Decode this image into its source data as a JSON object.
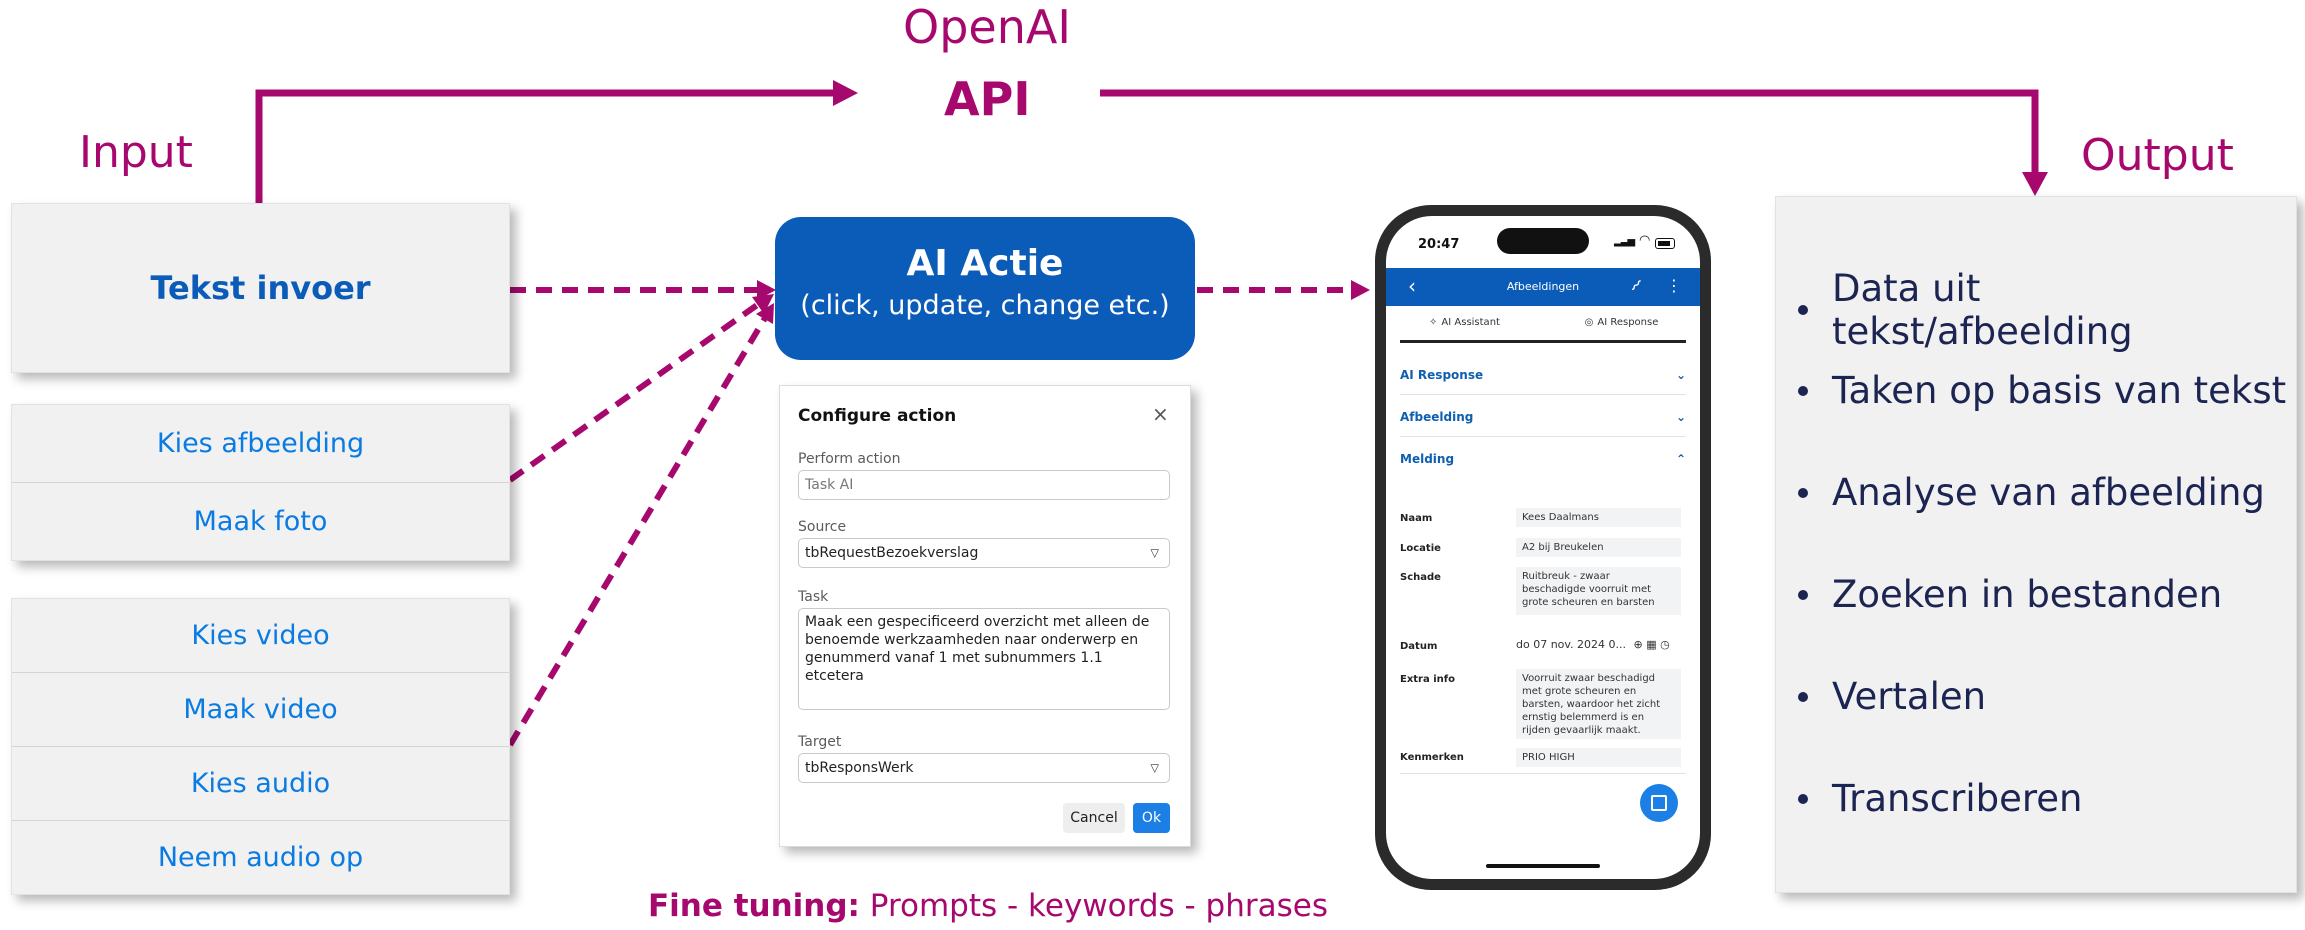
{
  "top": {
    "provider": "OpenAI",
    "api": "API",
    "input_label": "Input",
    "output_label": "Output"
  },
  "inputs": {
    "text": "Tekst invoer",
    "image_buttons": [
      "Kies afbeelding",
      "Maak foto"
    ],
    "media_buttons": [
      "Kies video",
      "Maak video",
      "Kies audio",
      "Neem audio op"
    ]
  },
  "action": {
    "title": "AI Actie",
    "subtitle": "(click, update, change etc.)"
  },
  "dialog": {
    "title": "Configure action",
    "close": "×",
    "perform_label": "Perform action",
    "perform_placeholder": "Task AI",
    "source_label": "Source",
    "source_value": "tbRequestBezoekverslag",
    "task_label": "Task",
    "task_value": "Maak een gespecificeerd overzicht met alleen de benoemde werkzaamheden naar onderwerp en genummerd vanaf 1 met subnummers 1.1 etcetera",
    "target_label": "Target",
    "target_value": "tbResponsWerk",
    "cancel": "Cancel",
    "ok": "Ok"
  },
  "fine_tuning": {
    "label": "Fine tuning:",
    "text": "Prompts - keywords - phrases"
  },
  "phone": {
    "time": "20:47",
    "header_title": "Afbeeldingen",
    "tab_assistant": "AI Assistant",
    "tab_response": "AI Response",
    "sections": [
      "AI Response",
      "Afbeelding",
      "Melding"
    ],
    "fields": [
      {
        "label": "Naam",
        "value": "Kees Daalmans"
      },
      {
        "label": "Locatie",
        "value": "A2 bij Breukelen"
      },
      {
        "label": "Schade",
        "value": "Ruitbreuk - zwaar beschadigde voorruit met grote scheuren en barsten"
      },
      {
        "label": "Datum",
        "value": "do 07 nov. 2024 0..."
      },
      {
        "label": "Extra info",
        "value": "Voorruit zwaar beschadigd met grote scheuren en barsten, waardoor het zicht ernstig belemmerd is en rijden gevaarlijk maakt."
      },
      {
        "label": "Kenmerken",
        "value": "PRIO HIGH"
      }
    ]
  },
  "outputs": [
    "Data uit tekst/afbeelding",
    "Taken op basis van tekst",
    "Analyse van afbeelding",
    "Zoeken in bestanden",
    "Vertalen",
    "Transcriberen"
  ],
  "colors": {
    "magenta": "#a6086e",
    "blue": "#0b5cb8",
    "link_blue": "#0a7be2",
    "navy": "#1c2452"
  }
}
